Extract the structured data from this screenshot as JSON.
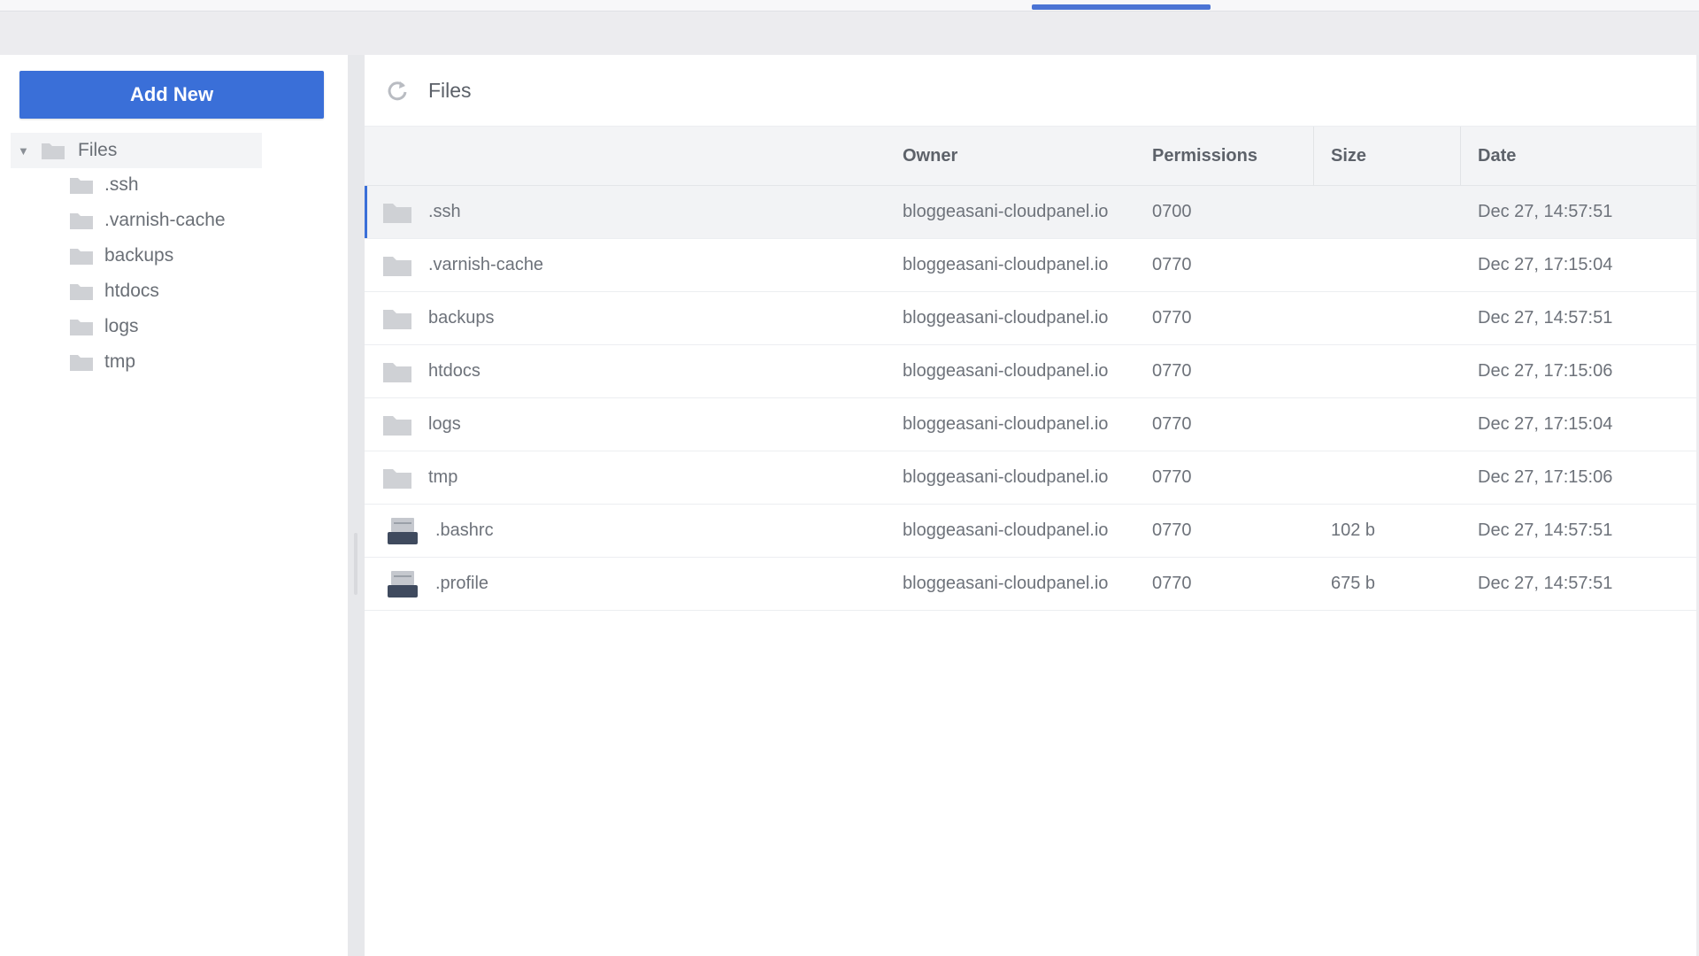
{
  "toolbar": {
    "add_new_label": "Add New"
  },
  "tree": {
    "root": {
      "label": "Files",
      "icon": "folder-icon",
      "expanded": true
    },
    "children": [
      {
        "label": ".ssh",
        "icon": "folder-icon"
      },
      {
        "label": ".varnish-cache",
        "icon": "folder-icon"
      },
      {
        "label": "backups",
        "icon": "folder-icon"
      },
      {
        "label": "htdocs",
        "icon": "folder-icon"
      },
      {
        "label": "logs",
        "icon": "folder-icon"
      },
      {
        "label": "tmp",
        "icon": "folder-icon"
      }
    ]
  },
  "main": {
    "title": "Files",
    "refresh_icon": "refresh-icon"
  },
  "table": {
    "columns": [
      "",
      "Owner",
      "Permissions",
      "Size",
      "Date"
    ],
    "rows": [
      {
        "name": ".ssh",
        "type": "folder",
        "owner": "bloggeasani-cloudpanel.io",
        "permissions": "0700",
        "size": "",
        "date": "Dec 27, 14:57:51",
        "selected": true
      },
      {
        "name": ".varnish-cache",
        "type": "folder",
        "owner": "bloggeasani-cloudpanel.io",
        "permissions": "0770",
        "size": "",
        "date": "Dec 27, 17:15:04",
        "selected": false
      },
      {
        "name": "backups",
        "type": "folder",
        "owner": "bloggeasani-cloudpanel.io",
        "permissions": "0770",
        "size": "",
        "date": "Dec 27, 14:57:51",
        "selected": false
      },
      {
        "name": "htdocs",
        "type": "folder",
        "owner": "bloggeasani-cloudpanel.io",
        "permissions": "0770",
        "size": "",
        "date": "Dec 27, 17:15:06",
        "selected": false
      },
      {
        "name": "logs",
        "type": "folder",
        "owner": "bloggeasani-cloudpanel.io",
        "permissions": "0770",
        "size": "",
        "date": "Dec 27, 17:15:04",
        "selected": false
      },
      {
        "name": "tmp",
        "type": "folder",
        "owner": "bloggeasani-cloudpanel.io",
        "permissions": "0770",
        "size": "",
        "date": "Dec 27, 17:15:06",
        "selected": false
      },
      {
        "name": ".bashrc",
        "type": "file",
        "owner": "bloggeasani-cloudpanel.io",
        "permissions": "0770",
        "size": "102 b",
        "date": "Dec 27, 14:57:51",
        "selected": false
      },
      {
        "name": ".profile",
        "type": "file",
        "owner": "bloggeasani-cloudpanel.io",
        "permissions": "0770",
        "size": "675 b",
        "date": "Dec 27, 14:57:51",
        "selected": false
      }
    ]
  },
  "colors": {
    "accent": "#3a6fd8",
    "folder": "#cfd1d5",
    "file_dark": "#3f4a5e"
  }
}
